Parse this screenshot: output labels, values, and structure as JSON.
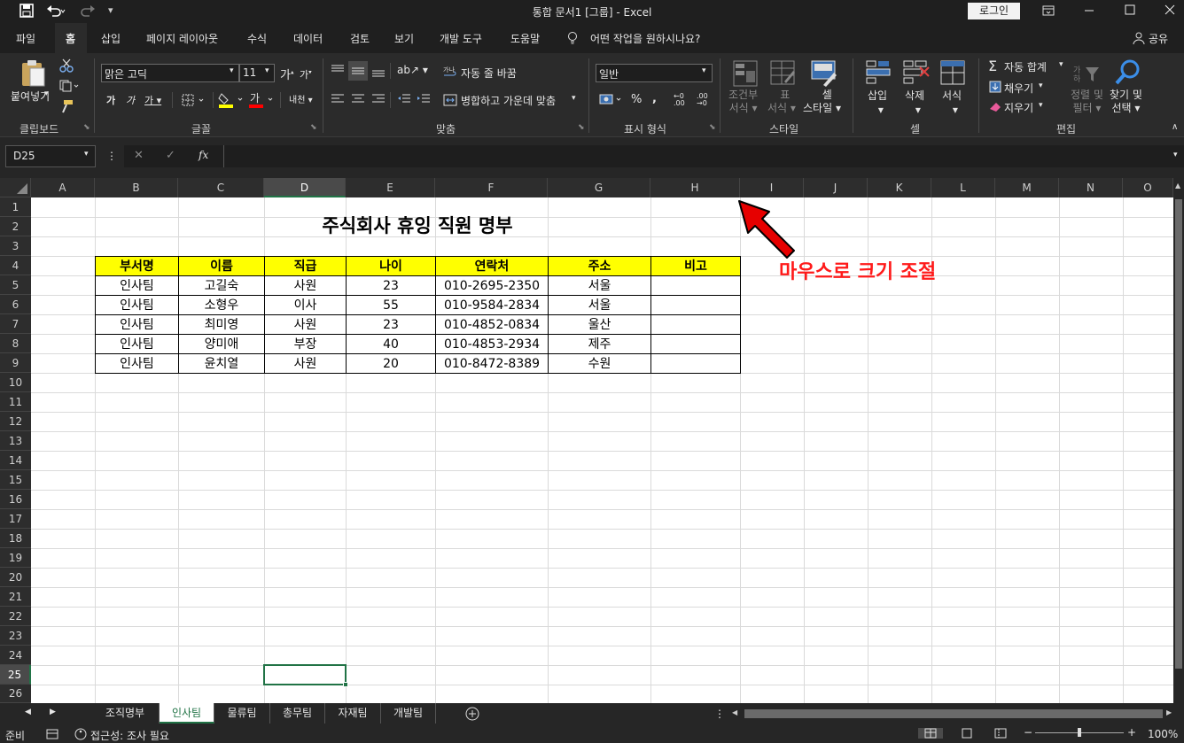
{
  "window": {
    "title": "통합 문서1 [그룹]  -  Excel",
    "login_label": "로그인",
    "min_icon": "minimize-icon",
    "max_icon": "maximize-icon",
    "close_icon": "close-icon"
  },
  "quick_access": {
    "save_icon": "save-icon",
    "undo_icon": "undo-icon",
    "redo_icon": "redo-icon"
  },
  "ribbon_tabs": [
    "파일",
    "홈",
    "삽입",
    "페이지 레이아웃",
    "수식",
    "데이터",
    "검토",
    "보기",
    "개발 도구",
    "도움말"
  ],
  "active_tab": "홈",
  "tell_me": "어떤 작업을 원하시나요?",
  "share_label": "공유",
  "ribbon": {
    "clipboard": {
      "paste_label": "붙여넣기",
      "group_label": "클립보드"
    },
    "font": {
      "font_name": "맑은 고딕",
      "font_size": "11",
      "group_label": "글꼴"
    },
    "alignment": {
      "wrap_text": "자동 줄 바꿈",
      "merge_center": "병합하고 가운데 맞춤",
      "group_label": "맞춤"
    },
    "number": {
      "format": "일반",
      "group_label": "표시 형식"
    },
    "styles": {
      "conditional_1": "조건부",
      "conditional_2": "서식",
      "table_1": "표",
      "table_2": "서식",
      "cell_style_1": "셀",
      "cell_style_2": "스타일",
      "group_label": "스타일"
    },
    "cells": {
      "insert": "삽입",
      "delete": "삭제",
      "format": "서식",
      "group_label": "셀"
    },
    "editing": {
      "autosum": "자동 합계",
      "fill": "채우기",
      "clear": "지우기",
      "sort_1": "정렬 및",
      "sort_2": "필터",
      "find_1": "찾기 및",
      "find_2": "선택",
      "group_label": "편집"
    }
  },
  "formula_bar": {
    "name_box": "D25",
    "fx": "fx",
    "formula": ""
  },
  "columns": [
    "A",
    "B",
    "C",
    "D",
    "E",
    "F",
    "G",
    "H",
    "I",
    "J",
    "K",
    "L",
    "M",
    "N",
    "O"
  ],
  "rows": [
    "1",
    "2",
    "3",
    "4",
    "5",
    "6",
    "7",
    "8",
    "9",
    "10",
    "11",
    "12",
    "13",
    "14",
    "15",
    "16",
    "17",
    "18",
    "19",
    "20",
    "21",
    "22",
    "23",
    "24",
    "25",
    "26"
  ],
  "active_cell": "D25",
  "sheet_title": "주식회사 휴잉 직원 명부",
  "table": {
    "headers": [
      "부서명",
      "이름",
      "직급",
      "나이",
      "연락처",
      "주소",
      "비고"
    ],
    "rows": [
      [
        "인사팀",
        "고길숙",
        "사원",
        "23",
        "010-2695-2350",
        "서울",
        ""
      ],
      [
        "인사팀",
        "소형우",
        "이사",
        "55",
        "010-9584-2834",
        "서울",
        ""
      ],
      [
        "인사팀",
        "최미영",
        "사원",
        "23",
        "010-4852-0834",
        "울산",
        ""
      ],
      [
        "인사팀",
        "양미애",
        "부장",
        "40",
        "010-4853-2934",
        "제주",
        ""
      ],
      [
        "인사팀",
        "윤치열",
        "사원",
        "20",
        "010-8472-8389",
        "수원",
        ""
      ]
    ],
    "header_color": "#ffff00"
  },
  "annotation": {
    "text": "마우스로 크기 조절",
    "color": "#ff1a1a"
  },
  "sheets": [
    "조직명부",
    "인사팀",
    "물류팀",
    "총무팀",
    "자재팀",
    "개발팀"
  ],
  "active_sheet": "인사팀",
  "status": {
    "ready": "준비",
    "accessibility": "접근성: 조사 필요",
    "zoom": "100%"
  }
}
